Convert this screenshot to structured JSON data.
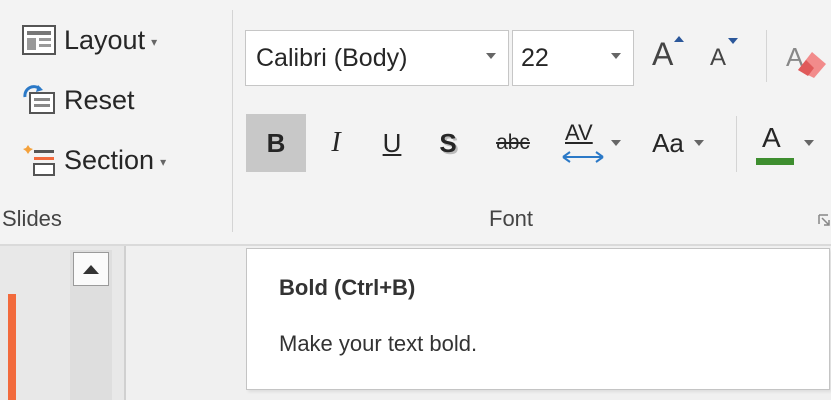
{
  "slides_group": {
    "layout_label": "Layout",
    "reset_label": "Reset",
    "section_label": "Section",
    "group_label": "Slides"
  },
  "font_group": {
    "font_name": "Calibri (Body)",
    "font_size": "22",
    "grow_label": "A",
    "shrink_label": "A",
    "bold_label": "B",
    "italic_label": "I",
    "underline_label": "U",
    "shadow_label": "S",
    "strike_label": "abc",
    "spacing_label": "AV",
    "case_label": "Aa",
    "color_label": "A",
    "group_label": "Font",
    "font_color": "#3e8e2f"
  },
  "tooltip": {
    "title": "Bold (Ctrl+B)",
    "description": "Make your text bold."
  },
  "colors": {
    "accent": "#2b579a",
    "slide_marker": "#f26a3c"
  }
}
